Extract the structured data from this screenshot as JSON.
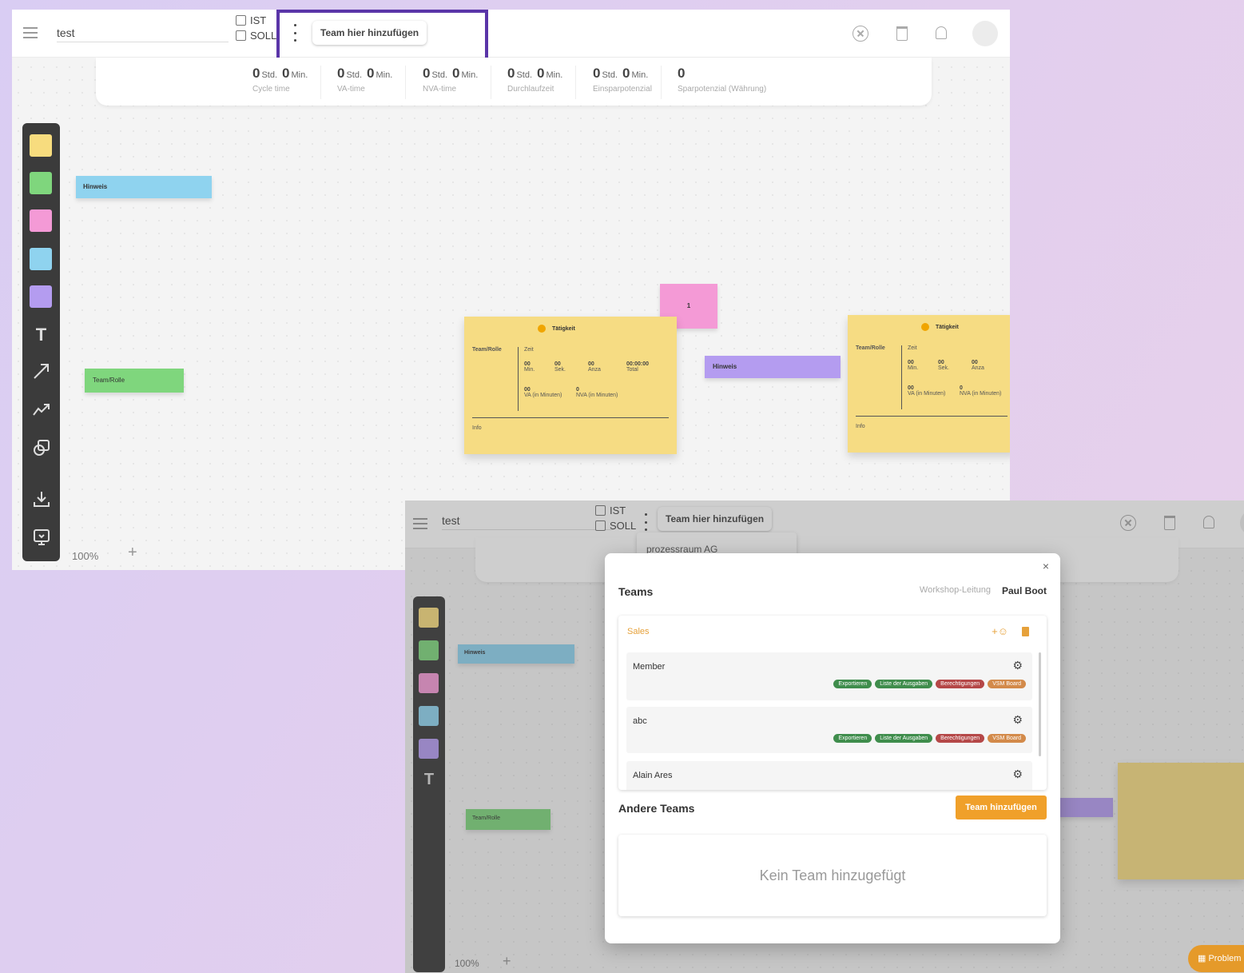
{
  "screen1": {
    "board_title": "test",
    "checkbox_ist": "IST",
    "checkbox_soll": "SOLL",
    "team_chip": "Team hier hinzufügen",
    "stats": [
      {
        "h": "0",
        "h_unit": "Std.",
        "m": "0",
        "m_unit": "Min.",
        "label": "Cycle time"
      },
      {
        "h": "0",
        "h_unit": "Std.",
        "m": "0",
        "m_unit": "Min.",
        "label": "VA-time"
      },
      {
        "h": "0",
        "h_unit": "Std.",
        "m": "0",
        "m_unit": "Min.",
        "label": "NVA-time"
      },
      {
        "h": "0",
        "h_unit": "Std.",
        "m": "0",
        "m_unit": "Min.",
        "label": "Durchlaufzeit"
      },
      {
        "h": "0",
        "h_unit": "Std.",
        "m": "0",
        "m_unit": "Min.",
        "label": "Einsparpotenzial"
      },
      {
        "value": "0",
        "label": "Sparpotenzial (Währung)"
      }
    ],
    "swatch_colors": [
      "#f7dc7e",
      "#7fd67d",
      "#f49ad6",
      "#8fd3ef",
      "#b49cf0"
    ],
    "tool_text": "T",
    "zoom": "100%",
    "zoom_plus": "+",
    "notes": {
      "hinweis_blue": "Hinweis",
      "team_rolle": "Team/Rolle",
      "pink_number": "1",
      "hinweis_purple": "Hinweis"
    },
    "activity_card": {
      "title": "Tätigkeit",
      "role": "Team/Rolle",
      "zeit": "Zeit",
      "min_val": "00",
      "min_lbl": "Min.",
      "sek_val": "00",
      "sek_lbl": "Sek.",
      "anzahl_val": "00",
      "anzahl_lbl": "Anza",
      "total_val": "00:00:00",
      "total_lbl": "Total",
      "va_val": "00",
      "va_lbl": "VA (in Minuten)",
      "nva_val": "0",
      "nva_lbl": "NVA (in Minuten)",
      "info": "Info"
    }
  },
  "screen2": {
    "board_title": "test",
    "checkbox_ist": "IST",
    "checkbox_soll": "SOLL",
    "team_chip": "Team hier hinzufügen",
    "dropdown_item": "prozessraum AG",
    "zoom": "100%",
    "zoom_plus": "+",
    "notes": {
      "hinweis_blue": "Hinweis",
      "team_rolle": "Team/Rolle"
    },
    "modal": {
      "close": "×",
      "title": "Teams",
      "leader_label": "Workshop-Leitung",
      "leader_name": "Paul Boot",
      "team_name": "Sales",
      "members": [
        {
          "name": "Member"
        },
        {
          "name": "abc"
        },
        {
          "name": "Alain Ares"
        }
      ],
      "tags": [
        {
          "label": "Exportieren",
          "color": "#3f8d4c"
        },
        {
          "label": "Liste der Ausgaben",
          "color": "#3f8d4c"
        },
        {
          "label": "Berechtigungen",
          "color": "#b54848"
        },
        {
          "label": "VSM Board",
          "color": "#d38a4a"
        }
      ],
      "other_teams": "Andere Teams",
      "add_team_button": "Team hinzufügen",
      "empty_text": "Kein Team hinzugefügt"
    },
    "problem_button": "Problem"
  }
}
